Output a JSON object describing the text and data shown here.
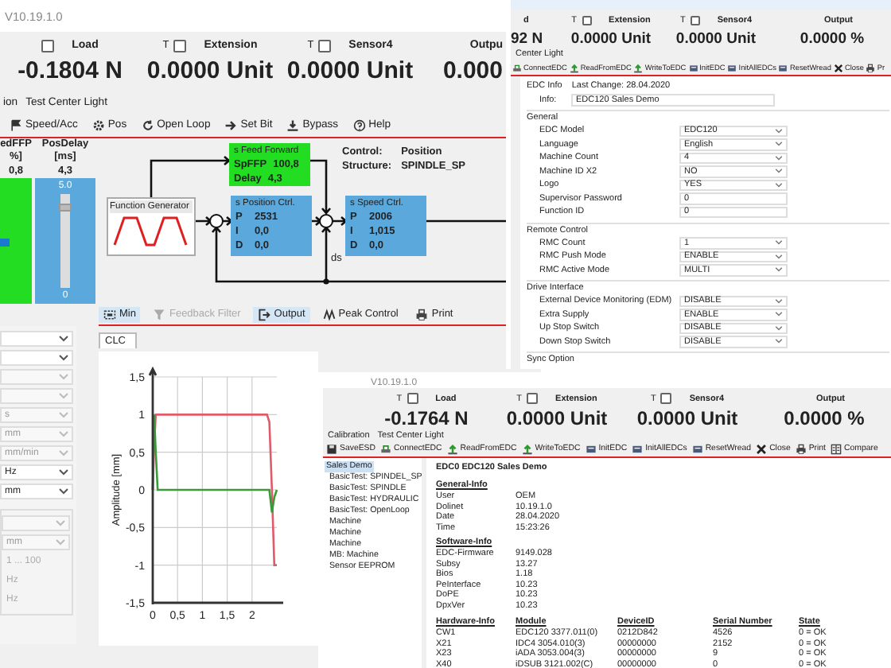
{
  "main_window": {
    "version": "V10.19.1.0",
    "sensors": [
      {
        "label": "Load",
        "value": "-0.1804 N",
        "checked": false
      },
      {
        "t": "T",
        "label": "Extension",
        "value": "0.0000 Unit",
        "checked": false
      },
      {
        "t": "T",
        "label": "Sensor4",
        "value": "0.0000 Unit",
        "checked": false
      },
      {
        "label": "Outpu",
        "value": "0.000"
      }
    ],
    "menu": [
      "ion",
      "Test Center Light"
    ],
    "toolbar": [
      "Speed/Acc",
      "Pos",
      "Open Loop",
      "Set Bit",
      "Bypass",
      "Help"
    ],
    "sliders": [
      {
        "title": "edFFP",
        "unit": "%]",
        "reading": "0,8",
        "level": 0.5,
        "color": "#22dd22"
      },
      {
        "title": "PosDelay",
        "unit": "[ms]",
        "reading": "4,3",
        "max": "5.0",
        "min": "0",
        "level": 0.86,
        "color": "#5aa8dc"
      }
    ],
    "diagram": {
      "function_generator": "Function Generator",
      "feed_forward": {
        "title": "s Feed Forward",
        "rows": [
          [
            "SpFFP",
            "100,8"
          ],
          [
            "Delay",
            "4,3"
          ]
        ]
      },
      "position_ctrl": {
        "title": "s Position Ctrl.",
        "rows": [
          [
            "P",
            "2531"
          ],
          [
            "I",
            "0,0"
          ],
          [
            "D",
            "0,0"
          ]
        ]
      },
      "speed_ctrl": {
        "title": "s Speed Ctrl.",
        "rows": [
          [
            "P",
            "2006"
          ],
          [
            "I",
            "1,015"
          ],
          [
            "D",
            "0,0"
          ]
        ]
      },
      "ds": "ds",
      "control": [
        "Control:",
        "Position"
      ],
      "structure": [
        "Structure:",
        "SPINDLE_SP"
      ]
    },
    "bottom_toolbar": [
      {
        "label": "Min",
        "selected": true,
        "disabled": false
      },
      {
        "label": "Feedback Filter",
        "selected": false,
        "disabled": true
      },
      {
        "label": "Output",
        "selected": true,
        "disabled": false
      },
      {
        "label": "Peak Control",
        "selected": false,
        "disabled": false
      },
      {
        "label": "Print",
        "selected": false,
        "disabled": false
      }
    ],
    "settings": [
      {
        "kind": "dropdown",
        "disabled": false
      },
      {
        "kind": "dropdown",
        "disabled": false
      },
      {
        "kind": "dropdown",
        "disabled": true
      },
      {
        "kind": "dropdown",
        "disabled": true
      },
      {
        "kind": "dropdown",
        "value": "s",
        "disabled": true
      },
      {
        "kind": "dropdown",
        "value": "mm",
        "disabled": true
      },
      {
        "kind": "dropdown",
        "value": "mm/min",
        "disabled": true
      },
      {
        "kind": "dropdown",
        "value": "Hz",
        "disabled": false
      },
      {
        "kind": "dropdown",
        "value": "mm",
        "disabled": false
      }
    ],
    "settings_group": [
      {
        "kind": "dropdown",
        "disabled": true
      },
      {
        "kind": "dropdown",
        "value": "mm",
        "disabled": true
      },
      {
        "kind": "text",
        "value": "1 ... 100",
        "disabled": true
      },
      {
        "kind": "text",
        "value": "Hz",
        "disabled": true
      },
      {
        "kind": "text",
        "value": "Hz",
        "disabled": true
      }
    ],
    "chart_tab": "CLC",
    "chart_data": {
      "type": "line",
      "ylabel": "Amplitude [mm]",
      "xlim": [
        0,
        2.5
      ],
      "ylim": [
        -1.5,
        1.5
      ],
      "xticks": [
        {
          "value": 0,
          "label": "0"
        },
        {
          "value": 0.5,
          "label": "0,5"
        },
        {
          "value": 1,
          "label": "1"
        },
        {
          "value": 1.5,
          "label": "1,5"
        },
        {
          "value": 2,
          "label": "2"
        }
      ],
      "yticks": [
        {
          "value": 1.5,
          "label": "1,5"
        },
        {
          "value": 1,
          "label": "1"
        },
        {
          "value": 0.5,
          "label": "0,5"
        },
        {
          "value": 0,
          "label": "0"
        },
        {
          "value": -0.5,
          "label": "-0,5"
        },
        {
          "value": -1,
          "label": "-1"
        },
        {
          "value": -1.5,
          "label": "-1,5"
        }
      ],
      "x": [
        0,
        0.03,
        0.06,
        0.1,
        0.5,
        1,
        1.5,
        2,
        2.3,
        2.35,
        2.4,
        2.45,
        2.5
      ],
      "grid": true,
      "series": [
        {
          "color": "#e05a6a",
          "values": [
            0,
            0.6,
            1,
            1,
            1,
            1,
            1,
            1,
            1,
            0.9,
            0,
            -1,
            -1
          ]
        },
        {
          "color": "#3a9a3a",
          "values": [
            0,
            1,
            0.5,
            0,
            0,
            0,
            0,
            0,
            0,
            0,
            -0.3,
            -0.1,
            0
          ]
        }
      ]
    }
  },
  "config_window": {
    "sensors": [
      {
        "label": "d",
        "value": "92 N"
      },
      {
        "t": "T",
        "label": "Extension",
        "value": "0.0000 Unit",
        "checked": false
      },
      {
        "t": "T",
        "label": "Sensor4",
        "value": "0.0000 Unit",
        "checked": false
      },
      {
        "label": "Output",
        "value": "0.0000 %"
      }
    ],
    "menu": [
      "Center Light"
    ],
    "toolbar": [
      "ConnectEDC",
      "ReadFromEDC",
      "WriteToEDC",
      "InitEDC",
      "InitAllEDCs",
      "ResetWread",
      "Close",
      "Pr"
    ],
    "header": [
      "EDC Info",
      "Last Change: 28.04.2020"
    ],
    "info": {
      "label": "Info:",
      "value": "EDC120 Sales Demo"
    },
    "groups": [
      {
        "title": "General",
        "fields": [
          {
            "label": "EDC Model",
            "value": "EDC120",
            "kind": "dropdown"
          },
          {
            "label": "Language",
            "value": "English",
            "kind": "dropdown"
          },
          {
            "label": "Machine Count",
            "value": "4",
            "kind": "dropdown"
          },
          {
            "label": "Machine ID X2",
            "value": "NO",
            "kind": "dropdown"
          },
          {
            "label": "Logo",
            "value": "YES",
            "kind": "dropdown"
          },
          {
            "label": "Supervisor Password",
            "value": "0",
            "kind": "input"
          },
          {
            "label": "Function ID",
            "value": "0",
            "kind": "input"
          }
        ]
      },
      {
        "title": "Remote Control",
        "fields": [
          {
            "label": "RMC Count",
            "value": "1",
            "kind": "dropdown"
          },
          {
            "label": "RMC Push Mode",
            "value": "ENABLE",
            "kind": "dropdown"
          },
          {
            "label": "RMC Active Mode",
            "value": "MULTI",
            "kind": "dropdown"
          }
        ]
      },
      {
        "title": "Drive Interface",
        "fields": [
          {
            "label": "External Device Monitoring (EDM)",
            "value": "DISABLE",
            "kind": "dropdown"
          },
          {
            "label": "Extra Supply",
            "value": "ENABLE",
            "kind": "dropdown"
          },
          {
            "label": "Up Stop Switch",
            "value": "DISABLE",
            "kind": "dropdown"
          },
          {
            "label": "Down Stop Switch",
            "value": "DISABLE",
            "kind": "dropdown"
          }
        ]
      }
    ],
    "last_group": "Sync Option"
  },
  "report_window": {
    "version": "V10.19.1.0",
    "sensors": [
      {
        "t": "T",
        "label": "Load",
        "value": "-0.1764 N",
        "checked": false
      },
      {
        "t": "T",
        "label": "Extension",
        "value": "0.0000 Unit",
        "checked": false
      },
      {
        "t": "T",
        "label": "Sensor4",
        "value": "0.0000 Unit",
        "checked": false
      },
      {
        "label": "Output",
        "value": "0.0000 %"
      }
    ],
    "menu": [
      "Calibration",
      "Test Center Light"
    ],
    "toolbar": [
      "SaveESD",
      "ConnectEDC",
      "ReadFromEDC",
      "WriteToEDC",
      "InitEDC",
      "InitAllEDCs",
      "ResetWread",
      "Close",
      "Print",
      "Compare"
    ],
    "tree": {
      "label": "Sales Demo",
      "selected": true,
      "children": [
        {
          "label": "BasicTest: SPINDEL_SP",
          "selected": false
        },
        {
          "label": "BasicTest: SPINDLE",
          "selected": false
        },
        {
          "label": "BasicTest: HYDRAULIC",
          "selected": false
        },
        {
          "label": "BasicTest: OpenLoop",
          "selected": false
        },
        {
          "label": "Machine",
          "selected": false
        },
        {
          "label": "Machine",
          "selected": false
        },
        {
          "label": "Machine",
          "selected": false
        },
        {
          "label": "MB: Machine",
          "selected": false
        },
        {
          "label": "Sensor EEPROM",
          "selected": false
        }
      ]
    },
    "report": {
      "title": "EDC0 EDC120 Sales Demo",
      "sections": [
        {
          "title": "General-Info",
          "rows": [
            [
              "User",
              "OEM"
            ],
            [
              "Dolinet",
              "10.19.1.0"
            ],
            [
              "Date",
              "28.04.2020"
            ],
            [
              "Time",
              "15:23:26"
            ]
          ]
        },
        {
          "title": "Software-Info",
          "rows": [
            [
              "EDC-Firmware",
              "9149.028"
            ],
            [
              "Subsy",
              "13.27"
            ],
            [
              "Bios",
              "1.18"
            ],
            [
              "PeInterface",
              "10.23"
            ],
            [
              "DoPE",
              "10.23"
            ],
            [
              "DpxVer",
              "10.23"
            ]
          ]
        }
      ],
      "hardware": {
        "columns": [
          "Hardware-Info",
          "Module",
          "DeviceID",
          "Serial Number",
          "State"
        ],
        "rows": [
          [
            "CW1",
            "EDC120   3377.011(0)",
            "0212D842",
            "4526",
            "0 = OK"
          ],
          [
            "X21",
            "IDC4   3054.010(3)",
            "00000000",
            "2152",
            "0 = OK"
          ],
          [
            "X23",
            "iADA   3053.004(3)",
            "00000000",
            "9",
            "0 = OK"
          ],
          [
            "X40",
            "iDSUB   3121.002(C)",
            "00000000",
            "0",
            "0 = OK"
          ]
        ]
      }
    }
  }
}
